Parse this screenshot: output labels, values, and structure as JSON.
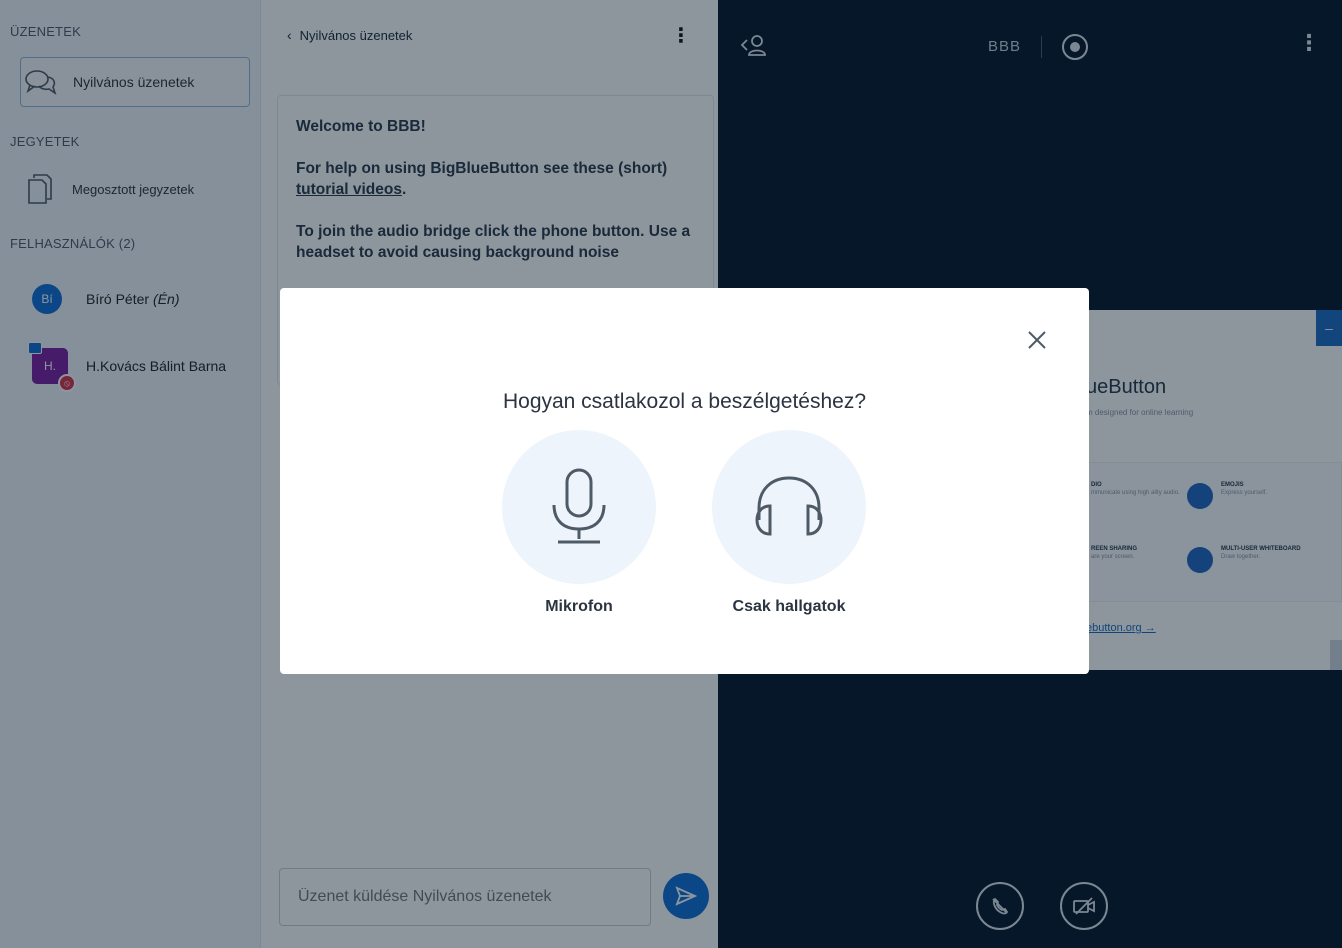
{
  "userlist": {
    "messages_title": "ÜZENETEK",
    "public_chat_label": "Nyilvános üzenetek",
    "notes_title": "JEGYETEK",
    "shared_notes_label": "Megosztott jegyzetek",
    "users_title": "FELHASZNÁLÓK (2)",
    "users": [
      {
        "initials": "Bí",
        "name": "Bíró Péter",
        "suffix": "(Én)"
      },
      {
        "initials": "H.",
        "name": "H.Kovács Bálint Barna",
        "suffix": ""
      }
    ]
  },
  "chat": {
    "back_icon": "‹",
    "title": "Nyilvános üzenetek",
    "menu_icon": "⋮",
    "welcome": {
      "line1_prefix": "Welcome to ",
      "line1_bold": "BBB!",
      "help_prefix": "For help on using BigBlueButton see these (short) ",
      "help_link": "tutorial videos",
      "help_suffix": ".",
      "audio_text": "To join the audio bridge click the phone button. Use a headset to avoid causing background noise"
    },
    "input_placeholder": "Üzenet küldése Nyilvános üzenetek"
  },
  "main": {
    "meeting_name": "BBB",
    "menu_icon": "⋮",
    "slide": {
      "title": "ueButton",
      "subtitle": "m designed for online learning",
      "features": [
        {
          "title": "DIO",
          "desc": "mmunicate using high ality audio."
        },
        {
          "title": "EMOJIS",
          "desc": "Express yourself."
        },
        {
          "title": "REEN SHARING",
          "desc": "are your screen."
        },
        {
          "title": "MULTI-USER WHITEBOARD",
          "desc": "Draw together."
        }
      ],
      "link": "ebutton.org →",
      "corner_label": "–"
    }
  },
  "modal": {
    "title": "Hogyan csatlakozol a beszélgetéshez?",
    "microphone_label": "Mikrofon",
    "listen_only_label": "Csak hallgatok",
    "accent_color": "#0f70d7",
    "icon_color": "#4e5a66"
  }
}
